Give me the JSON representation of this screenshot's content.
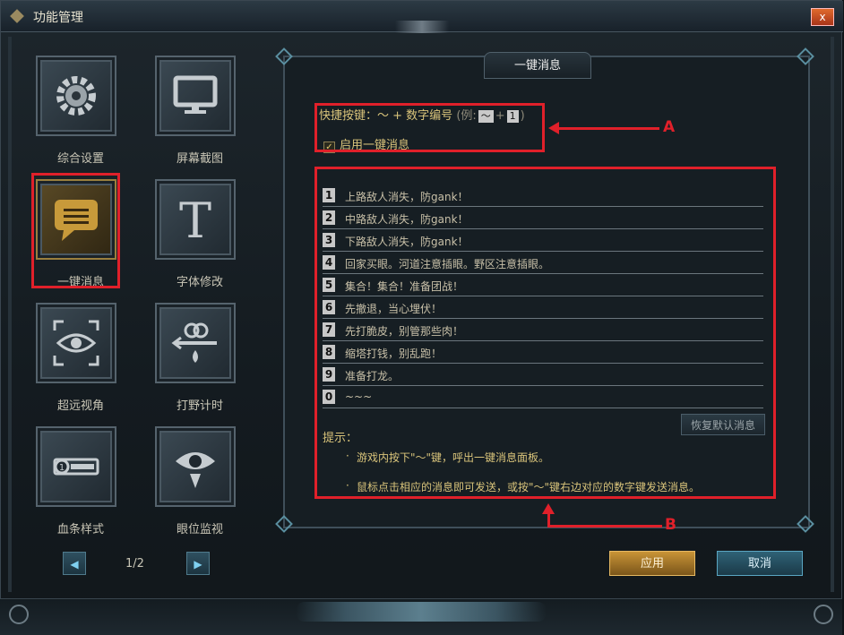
{
  "window": {
    "title": "功能管理",
    "close_label": "x"
  },
  "tools": [
    {
      "label": "综合设置",
      "icon": "gear-icon"
    },
    {
      "label": "屏幕截图",
      "icon": "monitor-icon"
    },
    {
      "label": "一键消息",
      "icon": "chat-bubble-icon"
    },
    {
      "label": "字体修改",
      "icon": "font-icon"
    },
    {
      "label": "超远视角",
      "icon": "eye-view-icon"
    },
    {
      "label": "打野计时",
      "icon": "timer-icon"
    },
    {
      "label": "血条样式",
      "icon": "health-bar-icon"
    },
    {
      "label": "眼位监视",
      "icon": "ward-eye-icon"
    }
  ],
  "pager": {
    "text": "1/2"
  },
  "panel": {
    "tab": "一键消息",
    "hotkey_label": "快捷按键：～ + 数字编号",
    "hotkey_example_prefix": "(例:",
    "hotkey_example_key1": "～",
    "hotkey_plus": "+",
    "hotkey_example_key2": "1",
    "hotkey_example_suffix": ")",
    "enable_label": "启用一键消息",
    "enable_checked": "✓",
    "messages": [
      {
        "num": "1",
        "text": "上路敌人消失，防gank！"
      },
      {
        "num": "2",
        "text": "中路敌人消失，防gank！"
      },
      {
        "num": "3",
        "text": "下路敌人消失，防gank！"
      },
      {
        "num": "4",
        "text": "回家买眼。河道注意插眼。野区注意插眼。"
      },
      {
        "num": "5",
        "text": "集合！集合！准备团战！"
      },
      {
        "num": "6",
        "text": "先撤退，当心埋伏！"
      },
      {
        "num": "7",
        "text": "先打脆皮，别管那些肉！"
      },
      {
        "num": "8",
        "text": "缩塔打钱，别乱跑！"
      },
      {
        "num": "9",
        "text": "准备打龙。"
      },
      {
        "num": "0",
        "text": "~~~"
      }
    ],
    "restore_label": "恢复默认消息",
    "tip_title": "提示：",
    "tips": [
      "游戏内按下\"～\"键，呼出一键消息面板。",
      "鼠标点击相应的消息即可发送，或按\"～\"键右边对应的数字键发送消息。"
    ],
    "tip_bullet": "·"
  },
  "annotations": {
    "a": "A",
    "b": "B"
  },
  "buttons": {
    "apply": "应用",
    "cancel": "取消"
  },
  "colors": {
    "highlight_red": "#e0202a",
    "gold_text": "#d8c37a",
    "apply_gold": "#c99437",
    "cancel_blue": "#2f6276"
  }
}
